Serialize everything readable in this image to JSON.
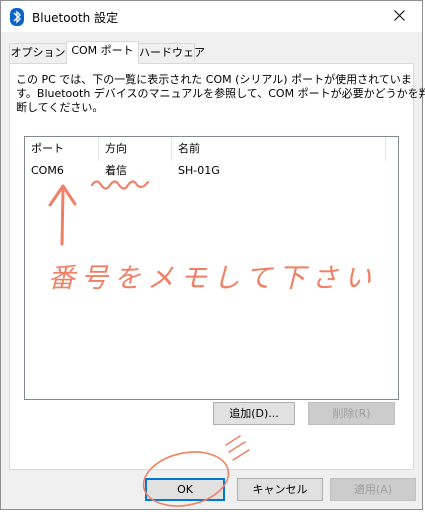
{
  "window": {
    "title": "Bluetooth 設定",
    "icon": "bluetooth-icon",
    "close_icon": "close-icon"
  },
  "tabs": [
    {
      "label": "オプション",
      "active": false
    },
    {
      "label": "COM ポート",
      "active": true
    },
    {
      "label": "ハードウェア",
      "active": false
    }
  ],
  "description": [
    "この PC では、下の一覧に表示された COM (シリアル) ポートが使用されていま",
    "す。Bluetooth デバイスのマニュアルを参照して、COM ポートが必要かどうかを判",
    "断してください。"
  ],
  "ports_table": {
    "columns": [
      "ポート",
      "方向",
      "名前"
    ],
    "rows": [
      [
        "COM6",
        "着信",
        "SH-01G"
      ]
    ]
  },
  "buttons": {
    "add": "追加(D)...",
    "delete": "削除(R)",
    "ok": "OK",
    "cancel": "キャンセル",
    "apply": "適用(A)"
  },
  "annotation": {
    "text": "番号をメモして下さい",
    "color": "#f07f65"
  }
}
